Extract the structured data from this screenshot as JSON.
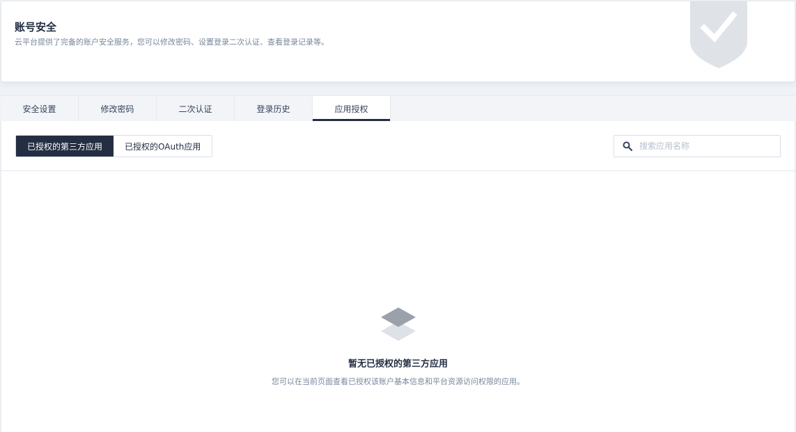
{
  "header": {
    "title": "账号安全",
    "description": "云平台提供了完备的账户安全服务，您可以修改密码、设置登录二次认证、查看登录记录等。",
    "icon": "shield-check-icon"
  },
  "tabs": [
    {
      "label": "安全设置",
      "active": false
    },
    {
      "label": "修改密码",
      "active": false
    },
    {
      "label": "二次认证",
      "active": false
    },
    {
      "label": "登录历史",
      "active": false
    },
    {
      "label": "应用授权",
      "active": true
    }
  ],
  "toolbar": {
    "segments": [
      {
        "label": "已授权的第三方应用",
        "active": true
      },
      {
        "label": "已授权的OAuth应用",
        "active": false
      }
    ],
    "search": {
      "placeholder": "搜索应用名称",
      "value": "",
      "icon": "search-icon"
    }
  },
  "empty_state": {
    "icon": "layers-icon",
    "title": "暂无已授权的第三方应用",
    "description": "您可以在当前页面查看已授权该账户基本信息和平台资源访问权限的应用。"
  },
  "colors": {
    "page_bg": "#eff2f6",
    "primary": "#242e42",
    "muted_text": "#79879c",
    "border": "#e3e9ef"
  }
}
